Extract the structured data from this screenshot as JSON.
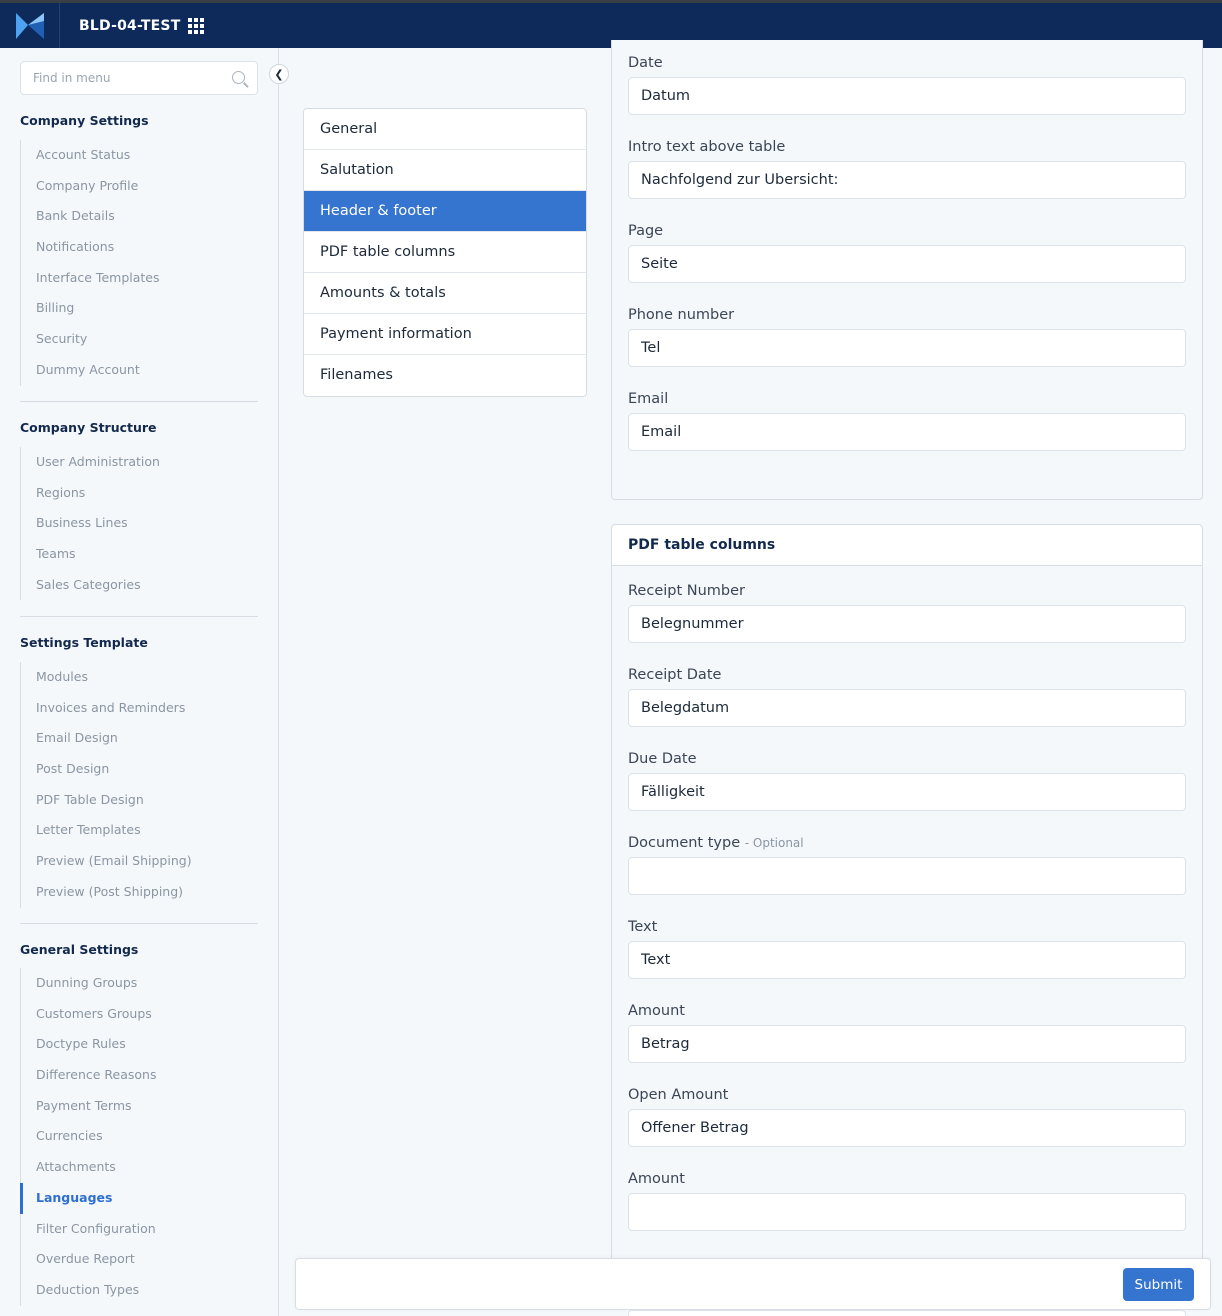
{
  "app": {
    "title": "BLD-04-TEST",
    "colors": {
      "topbar": "#0e2a5a",
      "accent": "#3574cf",
      "logo_light": "#4ea3f0",
      "logo_dark": "#1f5fb4"
    }
  },
  "sidebar": {
    "search_placeholder": "Find in menu",
    "sections": [
      {
        "title": "Company Settings",
        "items": [
          "Account Status",
          "Company Profile",
          "Bank Details",
          "Notifications",
          "Interface Templates",
          "Billing",
          "Security",
          "Dummy Account"
        ]
      },
      {
        "title": "Company Structure",
        "items": [
          "User Administration",
          "Regions",
          "Business Lines",
          "Teams",
          "Sales Categories"
        ]
      },
      {
        "title": "Settings Template",
        "items": [
          "Modules",
          "Invoices and Reminders",
          "Email Design",
          "Post Design",
          "PDF Table Design",
          "Letter Templates",
          "Preview (Email Shipping)",
          "Preview (Post Shipping)"
        ]
      },
      {
        "title": "General Settings",
        "items": [
          "Dunning Groups",
          "Customers Groups",
          "Doctype Rules",
          "Difference Reasons",
          "Payment Terms",
          "Currencies",
          "Attachments",
          "Languages",
          "Filter Configuration",
          "Overdue Report",
          "Deduction Types"
        ],
        "active": "Languages"
      }
    ]
  },
  "tabs": [
    "General",
    "Salutation",
    "Header & footer",
    "PDF table columns",
    "Amounts & totals",
    "Payment information",
    "Filenames"
  ],
  "active_tab": "Header & footer",
  "header_footer": {
    "fields": [
      {
        "label": "Date",
        "value": "Datum"
      },
      {
        "label": "Intro text above table",
        "value": "Nachfolgend zur Übersicht:"
      },
      {
        "label": "Page",
        "value": "Seite"
      },
      {
        "label": "Phone number",
        "value": "Tel"
      },
      {
        "label": "Email",
        "value": "Email"
      }
    ]
  },
  "pdf_columns": {
    "title": "PDF table columns",
    "optional_suffix": "- Optional",
    "fields": [
      {
        "label": "Receipt Number",
        "value": "Belegnummer"
      },
      {
        "label": "Receipt Date",
        "value": "Belegdatum"
      },
      {
        "label": "Due Date",
        "value": "Fälligkeit"
      },
      {
        "label": "Document type",
        "value": ""
      },
      {
        "label": "Text",
        "value": "Text"
      },
      {
        "label": "Amount",
        "value": "Betrag"
      },
      {
        "label": "Open Amount",
        "value": "Offener Betrag"
      },
      {
        "label": "Amount",
        "value": ""
      }
    ]
  },
  "actions": {
    "submit_label": "Submit"
  }
}
